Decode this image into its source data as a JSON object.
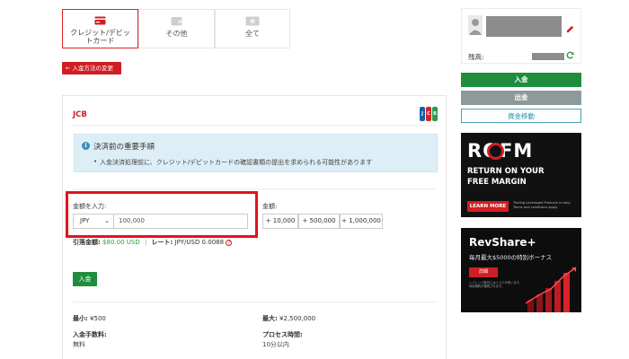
{
  "tabs": [
    {
      "label_line1": "クレジット/デビッ",
      "label_line2": "トカード",
      "icon": "credit-card-icon"
    },
    {
      "label": "その他",
      "icon": "wallet-icon"
    },
    {
      "label": "全て",
      "icon": "cash-icon"
    }
  ],
  "back_button": "← 入金方法の変更",
  "method": {
    "title": "JCB",
    "logo_letters": [
      "J",
      "C",
      "B"
    ],
    "notice": {
      "title": "決済前の重要手順",
      "body": "入金決済処理前に、クレジット/デビットカードの確認書類の提出を求められる可能性があります"
    },
    "amount_label": "金額を入力:",
    "currency": "JPY",
    "amount_value": "100,000",
    "quick_label": "金額:",
    "quick_amounts": [
      "+ 10,000",
      "+ 500,000",
      "+ 1,000,000"
    ],
    "debit_label": "引落金額:",
    "debit_value": "$80.00 USD",
    "separator": "|",
    "rate_label": "レート:",
    "rate_value": "JPY/USD 0.0088",
    "deposit_button": "入金",
    "min_label": "最小:",
    "min_value": "¥500",
    "max_label": "最大:",
    "max_value": "¥2,500,000",
    "fee_label": "入金手数料:",
    "fee_value": "無料",
    "process_label": "プロセス時間:",
    "process_value": "10分以内"
  },
  "sidebar": {
    "balance_label": "残高:",
    "deposit": "入金",
    "withdraw": "出金",
    "transfer": "資金移動"
  },
  "banners": {
    "rofm": {
      "logo": "ROFM",
      "line1": "RETURN ON YOUR",
      "line2": "FREE MARGIN",
      "cta": "LEARN MORE",
      "fine": "Trading Leveraged Products is risky. Terms and conditions apply."
    },
    "revshare": {
      "title": "RevShare+",
      "subtitle": "毎月最大$5000の特別ボーナス",
      "cta": "詳細",
      "fine": "レバレッジ取引にはリスクが伴います。利用規約が適用されます。"
    }
  },
  "colors": {
    "accent_red": "#d01f24",
    "green": "#1e8e3e",
    "notice_bg": "#ddeef6"
  }
}
